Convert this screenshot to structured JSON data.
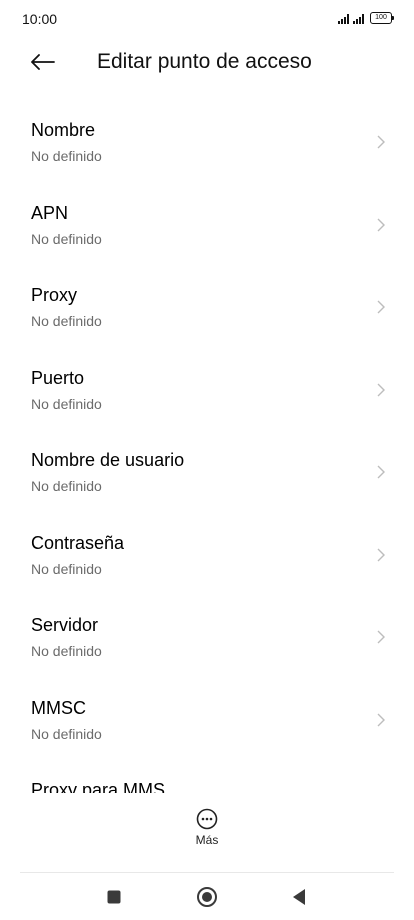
{
  "status_bar": {
    "time": "10:00",
    "battery": "100",
    "icons": [
      "signal-icon",
      "signal-icon",
      "battery-icon"
    ]
  },
  "header": {
    "title": "Editar punto de acceso",
    "back_icon": "back-arrow-icon"
  },
  "fields": [
    {
      "label": "Nombre",
      "value": "No definido"
    },
    {
      "label": "APN",
      "value": "No definido"
    },
    {
      "label": "Proxy",
      "value": "No definido"
    },
    {
      "label": "Puerto",
      "value": "No definido"
    },
    {
      "label": "Nombre de usuario",
      "value": "No definido"
    },
    {
      "label": "Contraseña",
      "value": "No definido"
    },
    {
      "label": "Servidor",
      "value": "No definido"
    },
    {
      "label": "MMSC",
      "value": "No definido"
    },
    {
      "label": "Proxy para MMS",
      "value": ""
    }
  ],
  "more": {
    "label": "Más",
    "icon": "more-icon"
  },
  "nav": {
    "recent_icon": "recent-apps-icon",
    "home_icon": "home-icon",
    "back_icon": "nav-back-icon"
  },
  "colors": {
    "text_primary": "#000000",
    "text_secondary": "#6b6b6b",
    "chevron": "#bdbdbd",
    "background": "#ffffff"
  }
}
